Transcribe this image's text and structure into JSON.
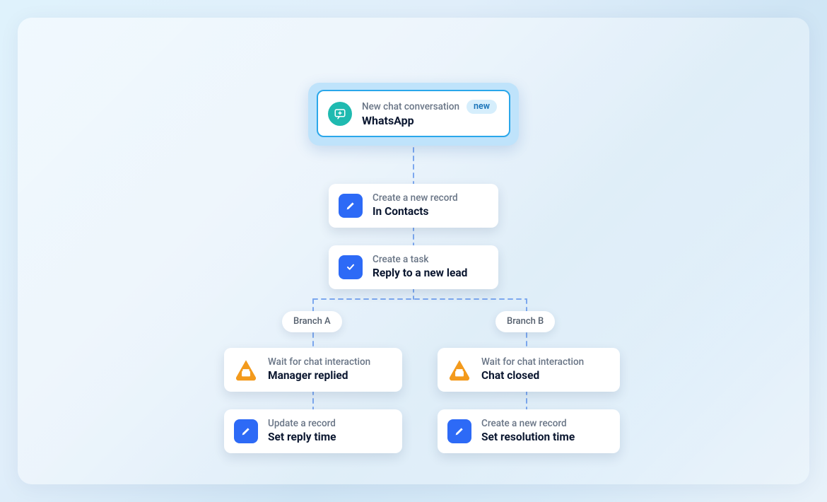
{
  "trigger": {
    "label": "New chat conversation",
    "badge": "new",
    "title": "WhatsApp",
    "icon_name": "chat-plus-icon"
  },
  "branches": {
    "a": {
      "label": "Branch A"
    },
    "b": {
      "label": "Branch B"
    }
  },
  "nodes": {
    "create_record": {
      "label": "Create a new record",
      "title": "In Contacts",
      "icon_name": "pencil-icon"
    },
    "create_task": {
      "label": "Create a task",
      "title": "Reply to a new lead",
      "icon_name": "check-icon"
    },
    "wait_manager_replied": {
      "label": "Wait for chat interaction",
      "title": "Manager replied",
      "icon_name": "wait-triangle-icon"
    },
    "update_reply_time": {
      "label": "Update a record",
      "title": "Set reply time",
      "icon_name": "pencil-icon"
    },
    "wait_chat_closed": {
      "label": "Wait for chat interaction",
      "title": "Chat closed",
      "icon_name": "wait-triangle-icon"
    },
    "create_resolution": {
      "label": "Create a new record",
      "title": "Set resolution time",
      "icon_name": "pencil-icon"
    }
  },
  "colors": {
    "connector": "#7ca8ef",
    "accent_blue": "#2d6af6",
    "accent_teal": "#1fbab0",
    "accent_orange": "#f39a1c",
    "trigger_outline": "#2aa7ea",
    "trigger_frame": "#bfe3fb",
    "badge_bg": "#d6eefc",
    "badge_text": "#1973b8"
  }
}
